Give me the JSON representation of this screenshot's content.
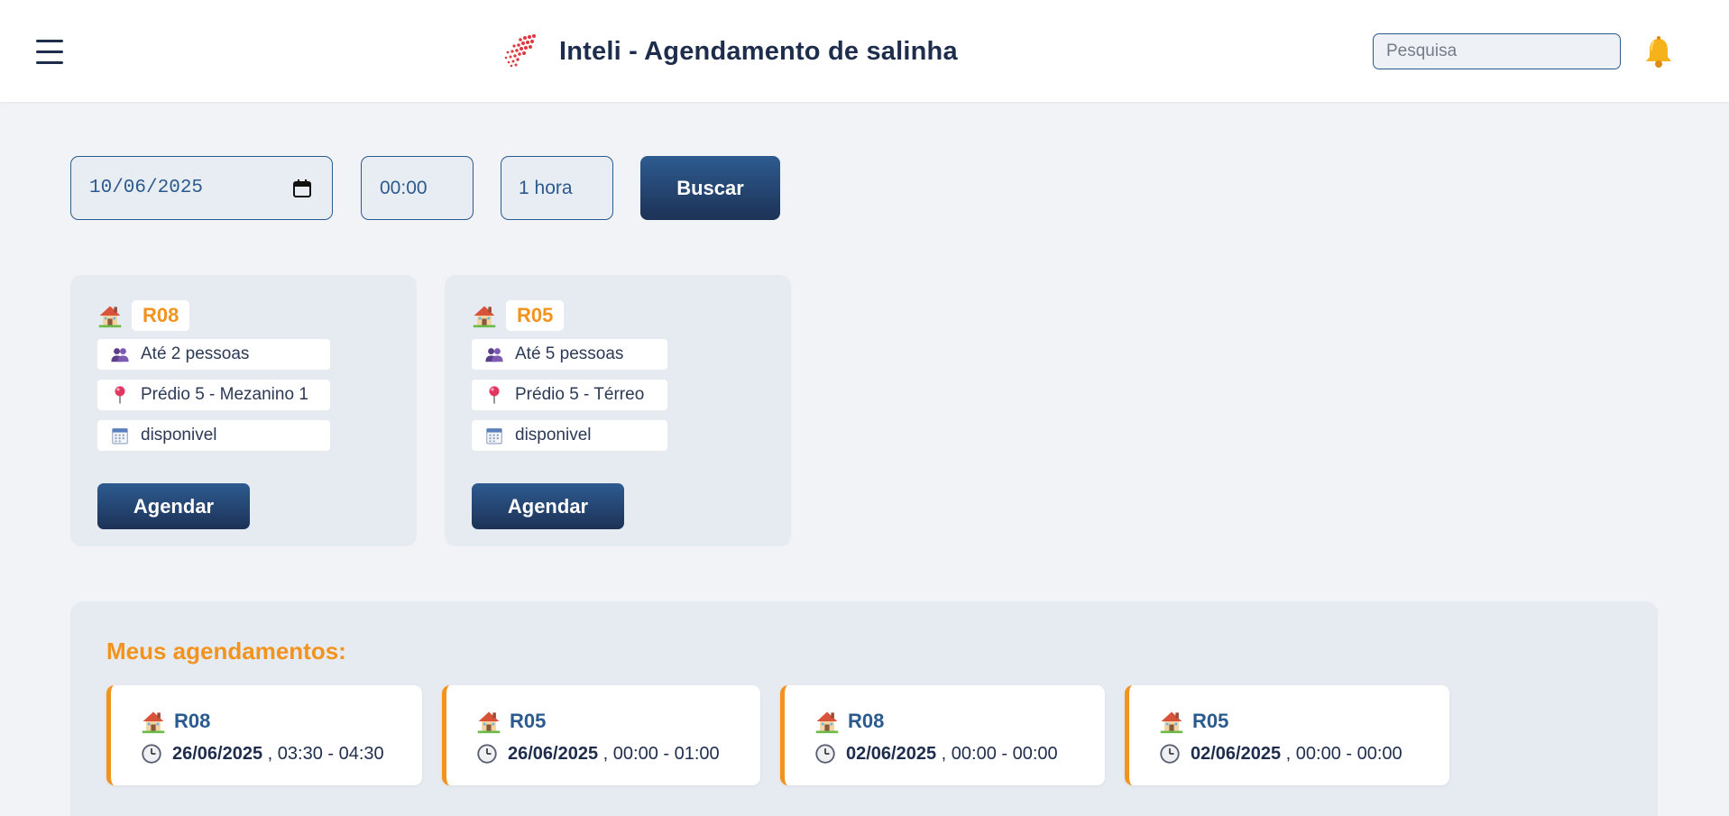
{
  "header": {
    "title": "Inteli - Agendamento de salinha",
    "search_placeholder": "Pesquisa"
  },
  "filters": {
    "date": "10/06/2025",
    "time": "00:00",
    "duration": "1 hora",
    "search_button": "Buscar"
  },
  "rooms": [
    {
      "code": "R08",
      "capacity": "Até 2 pessoas",
      "location": "Prédio 5 - Mezanino 1",
      "status": "disponivel",
      "button": "Agendar"
    },
    {
      "code": "R05",
      "capacity": "Até 5 pessoas",
      "location": "Prédio 5 - Térreo",
      "status": "disponivel",
      "button": "Agendar"
    }
  ],
  "bookings": {
    "title": "Meus agendamentos:",
    "items": [
      {
        "room": "R08",
        "date": "26/06/2025",
        "time": ", 03:30 - 04:30"
      },
      {
        "room": "R05",
        "date": "26/06/2025",
        "time": ", 00:00 - 01:00"
      },
      {
        "room": "R08",
        "date": "02/06/2025",
        "time": ", 00:00 - 00:00"
      },
      {
        "room": "R05",
        "date": "02/06/2025",
        "time": ", 00:00 - 00:00"
      }
    ]
  },
  "colors": {
    "primary": "#1f2d4d",
    "accent": "#f2931e",
    "link": "#2b5a8e"
  },
  "icons": [
    "menu-icon",
    "inteli-logo",
    "bell-icon",
    "calendar-icon",
    "house-icon",
    "people-icon",
    "pin-icon",
    "clock-icon"
  ]
}
